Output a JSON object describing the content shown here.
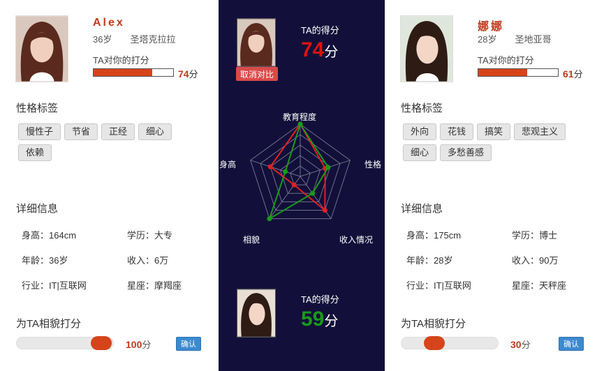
{
  "left": {
    "name": "Alex",
    "age": "36岁",
    "location": "圣塔克拉拉",
    "rate_label": "TA对你的打分",
    "rate_value": "74",
    "rate_unit": "分",
    "rate_fraction": 0.74,
    "tags_title": "性格标签",
    "tags": [
      "慢性子",
      "节省",
      "正经",
      "细心",
      "依赖"
    ],
    "details_title": "详细信息",
    "details": [
      "身高：164cm",
      "学历：大专",
      "年龄：36岁",
      "收入：6万",
      "行业：IT|互联网",
      "星座：摩羯座"
    ],
    "score_title": "为TA相貌打分",
    "slider_value": "100",
    "slider_unit": "分",
    "slider_fraction": 1.0,
    "confirm": "确认"
  },
  "right": {
    "name": "娜娜",
    "age": "28岁",
    "location": "圣地亚哥",
    "rate_label": "TA对你的打分",
    "rate_value": "61",
    "rate_unit": "分",
    "rate_fraction": 0.61,
    "tags_title": "性格标签",
    "tags": [
      "外向",
      "花钱",
      "搞笑",
      "悲观主义",
      "细心",
      "多愁善感"
    ],
    "details_title": "详细信息",
    "details": [
      "身高：175cm",
      "学历：博士",
      "年龄：28岁",
      "收入：90万",
      "行业：IT|互联网",
      "星座：天秤座"
    ],
    "score_title": "为TA相貌打分",
    "slider_value": "30",
    "slider_unit": "分",
    "slider_fraction": 0.3,
    "confirm": "确认"
  },
  "center": {
    "cancel": "取消对比",
    "top_score_label": "TA的得分",
    "top_score": "74",
    "top_score_unit": "分",
    "top_score_color": "#e01010",
    "bottom_score_label": "TA的得分",
    "bottom_score": "59",
    "bottom_score_unit": "分",
    "bottom_score_color": "#1a9a1a",
    "background": "#12103a"
  },
  "chart_data": {
    "type": "radar",
    "axes": [
      "教育程度",
      "性格",
      "收入情况",
      "相貌",
      "身高"
    ],
    "max": 5,
    "series": [
      {
        "color": "#e02020",
        "values": [
          5,
          2.5,
          4,
          1,
          3
        ]
      },
      {
        "color": "#1a9a1a",
        "values": [
          5,
          2.8,
          2,
          5,
          1.5
        ]
      }
    ]
  }
}
